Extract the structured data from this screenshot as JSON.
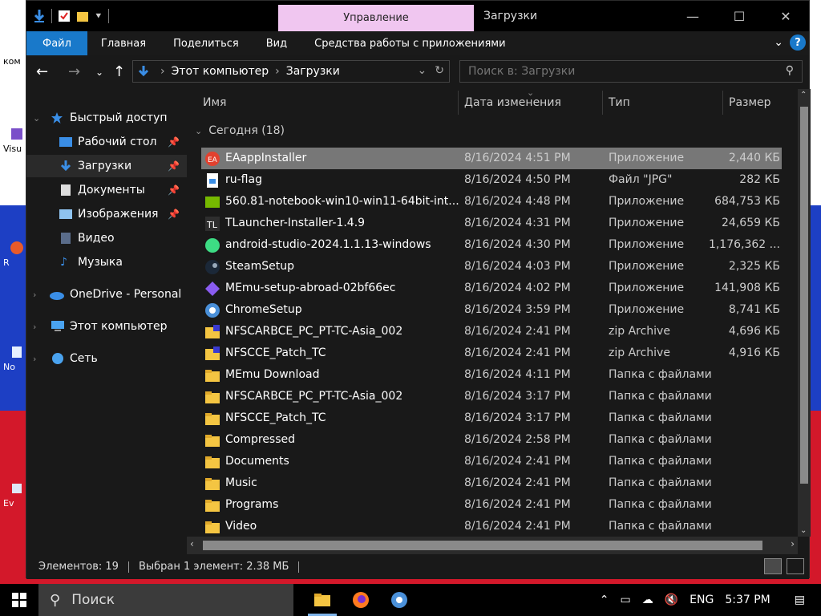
{
  "desktop": {
    "icons": [
      {
        "label": "ком"
      },
      {
        "label": "Visu"
      },
      {
        "label": "R"
      },
      {
        "label": "No"
      },
      {
        "label": "Ev"
      }
    ]
  },
  "titlebar": {
    "manage_tab": "Управление",
    "title": "Загрузки"
  },
  "ribbon": {
    "tabs": [
      "Файл",
      "Главная",
      "Поделиться",
      "Вид",
      "Средства работы с приложениями"
    ],
    "help": "?"
  },
  "address": {
    "root": "Этот компьютер",
    "current": "Загрузки"
  },
  "search": {
    "placeholder": "Поиск в: Загрузки"
  },
  "nav": {
    "quick_access": "Быстрый доступ",
    "desktop": "Рабочий стол",
    "downloads": "Загрузки",
    "documents": "Документы",
    "pictures": "Изображения",
    "video": "Видео",
    "music": "Музыка",
    "onedrive": "OneDrive - Personal",
    "this_pc": "Этот компьютер",
    "network": "Сеть"
  },
  "columns": {
    "name": "Имя",
    "date": "Дата изменения",
    "type": "Тип",
    "size": "Размер"
  },
  "group": {
    "label": "Сегодня (18)"
  },
  "files": [
    {
      "name": "EAappInstaller",
      "date": "8/16/2024 4:51 PM",
      "type": "Приложение",
      "size": "2,440 КБ",
      "icon": "ea-icon"
    },
    {
      "name": "ru-flag",
      "date": "8/16/2024 4:50 PM",
      "type": "Файл \"JPG\"",
      "size": "282 КБ",
      "icon": "image-file-icon"
    },
    {
      "name": "560.81-notebook-win10-win11-64bit-int...",
      "date": "8/16/2024 4:48 PM",
      "type": "Приложение",
      "size": "684,753 КБ",
      "icon": "nvidia-icon"
    },
    {
      "name": "TLauncher-Installer-1.4.9",
      "date": "8/16/2024 4:31 PM",
      "type": "Приложение",
      "size": "24,659 КБ",
      "icon": "tlauncher-icon"
    },
    {
      "name": "android-studio-2024.1.1.13-windows",
      "date": "8/16/2024 4:30 PM",
      "type": "Приложение",
      "size": "1,176,362 ...",
      "icon": "android-studio-icon"
    },
    {
      "name": "SteamSetup",
      "date": "8/16/2024 4:03 PM",
      "type": "Приложение",
      "size": "2,325 КБ",
      "icon": "steam-icon"
    },
    {
      "name": "MEmu-setup-abroad-02bf66ec",
      "date": "8/16/2024 4:02 PM",
      "type": "Приложение",
      "size": "141,908 КБ",
      "icon": "memu-icon"
    },
    {
      "name": "ChromeSetup",
      "date": "8/16/2024 3:59 PM",
      "type": "Приложение",
      "size": "8,741 КБ",
      "icon": "chrome-setup-icon"
    },
    {
      "name": "NFSCARBCE_PC_PT-TC-Asia_002",
      "date": "8/16/2024 2:41 PM",
      "type": "zip Archive",
      "size": "4,696 КБ",
      "icon": "zip-icon"
    },
    {
      "name": "NFSCCE_Patch_TC",
      "date": "8/16/2024 2:41 PM",
      "type": "zip Archive",
      "size": "4,916 КБ",
      "icon": "zip-icon"
    },
    {
      "name": "MEmu Download",
      "date": "8/16/2024 4:11 PM",
      "type": "Папка с файлами",
      "size": "",
      "icon": "folder-icon"
    },
    {
      "name": "NFSCARBCE_PC_PT-TC-Asia_002",
      "date": "8/16/2024 3:17 PM",
      "type": "Папка с файлами",
      "size": "",
      "icon": "folder-icon"
    },
    {
      "name": "NFSCCE_Patch_TC",
      "date": "8/16/2024 3:17 PM",
      "type": "Папка с файлами",
      "size": "",
      "icon": "folder-icon"
    },
    {
      "name": "Compressed",
      "date": "8/16/2024 2:58 PM",
      "type": "Папка с файлами",
      "size": "",
      "icon": "folder-icon"
    },
    {
      "name": "Documents",
      "date": "8/16/2024 2:41 PM",
      "type": "Папка с файлами",
      "size": "",
      "icon": "folder-icon"
    },
    {
      "name": "Music",
      "date": "8/16/2024 2:41 PM",
      "type": "Папка с файлами",
      "size": "",
      "icon": "folder-icon"
    },
    {
      "name": "Programs",
      "date": "8/16/2024 2:41 PM",
      "type": "Папка с файлами",
      "size": "",
      "icon": "folder-icon"
    },
    {
      "name": "Video",
      "date": "8/16/2024 2:41 PM",
      "type": "Папка с файлами",
      "size": "",
      "icon": "folder-icon"
    }
  ],
  "selected_index": 0,
  "status": {
    "items": "Элементов: 19",
    "selection": "Выбран 1 элемент: 2.38 МБ"
  },
  "taskbar": {
    "search": "Поиск",
    "lang": "ENG",
    "time": "5:37 PM"
  },
  "colors": {
    "accent": "#1979ca",
    "manage_tab": "#f0c6f0",
    "selection": "#777777",
    "window_bg": "#191919"
  }
}
